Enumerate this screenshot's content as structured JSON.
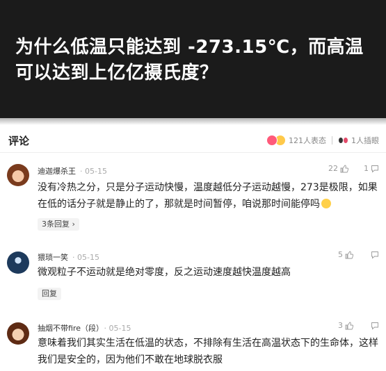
{
  "header": {
    "title": "为什么低温只能达到 -273.15℃，而高温可以达到上亿亿摄氏度？"
  },
  "bar": {
    "title": "评论",
    "reaction_count": "121人表态",
    "insert_count": "1人插眼"
  },
  "comments": [
    {
      "author": "迪迦爆杀王",
      "date": "05-15",
      "likes": "22",
      "replies": "1",
      "text": "没有冷热之分，只是分子运动快慢，温度越低分子运动越慢，273是极限，如果在低的话分子就是静止的了，那就是时间暂停，咱说那时间能停吗",
      "reply_label": "3条回复 ›"
    },
    {
      "author": "猥琐一笑",
      "date": "05-15",
      "likes": "5",
      "text": "微观粒子不运动就是绝对零度，反之运动速度越快温度越高",
      "reply_label": "回复"
    },
    {
      "author": "抽烟不带fire（段）",
      "date": "05-15",
      "likes": "3",
      "text": "意味着我们其实生活在低温的状态，不排除有生活在高温状态下的生命体，这样我们是安全的，因为他们不敢在地球脱衣服"
    }
  ],
  "colors": {
    "header_bg": "#1b1b1b",
    "heart": "#ff5a7a",
    "face": "#ffc94a"
  },
  "icons": [
    "heart-reaction-icon",
    "face-reaction-icon",
    "eyes-icon",
    "thumbs-up-icon",
    "reply-bubble-icon",
    "emoji-icon"
  ]
}
